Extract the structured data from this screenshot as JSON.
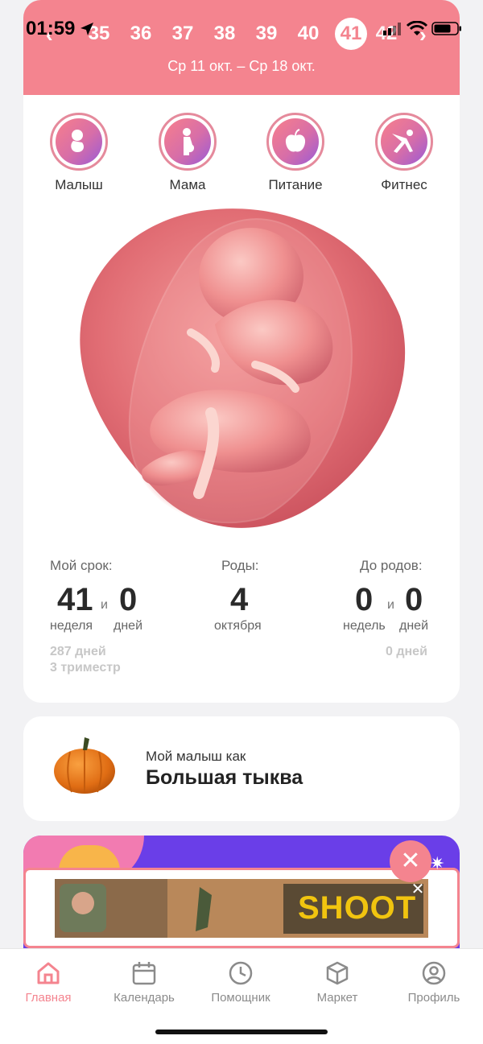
{
  "status_bar": {
    "time": "01:59"
  },
  "weeks": {
    "items": [
      "35",
      "36",
      "37",
      "38",
      "39",
      "40"
    ],
    "active": "41",
    "next_partial": "42",
    "range": "Ср 11 окт. – Ср 18 окт."
  },
  "categories": [
    {
      "label": "Малыш",
      "icon": "baby-icon"
    },
    {
      "label": "Мама",
      "icon": "pregnant-mom-icon"
    },
    {
      "label": "Питание",
      "icon": "apple-icon"
    },
    {
      "label": "Фитнес",
      "icon": "yoga-icon"
    }
  ],
  "stats": {
    "term": {
      "title": "Мой срок:",
      "weeks": "41",
      "and": "и",
      "days": "0",
      "weeks_unit": "неделя",
      "days_unit": "дней",
      "total_days": "287 дней",
      "trimester": "3 триместр"
    },
    "birth": {
      "title": "Роды:",
      "day": "4",
      "month": "октября"
    },
    "until": {
      "title": "До родов:",
      "weeks": "0",
      "and": "и",
      "days": "0",
      "weeks_unit": "недель",
      "days_unit": "дней",
      "total_days": "0 дней"
    }
  },
  "baby_size": {
    "subtitle": "Мой малыш как",
    "title": "Большая тыква"
  },
  "ad": {
    "banner_text": "SHOOT",
    "close": "✕"
  },
  "promo": {
    "close": "✕"
  },
  "tabs": [
    {
      "label": "Главная",
      "icon": "home-icon"
    },
    {
      "label": "Календарь",
      "icon": "calendar-icon"
    },
    {
      "label": "Помощник",
      "icon": "clock-icon"
    },
    {
      "label": "Маркет",
      "icon": "box-icon"
    },
    {
      "label": "Профиль",
      "icon": "profile-icon"
    }
  ],
  "colors": {
    "accent": "#f4848f",
    "promo": "#6a3ee8"
  }
}
